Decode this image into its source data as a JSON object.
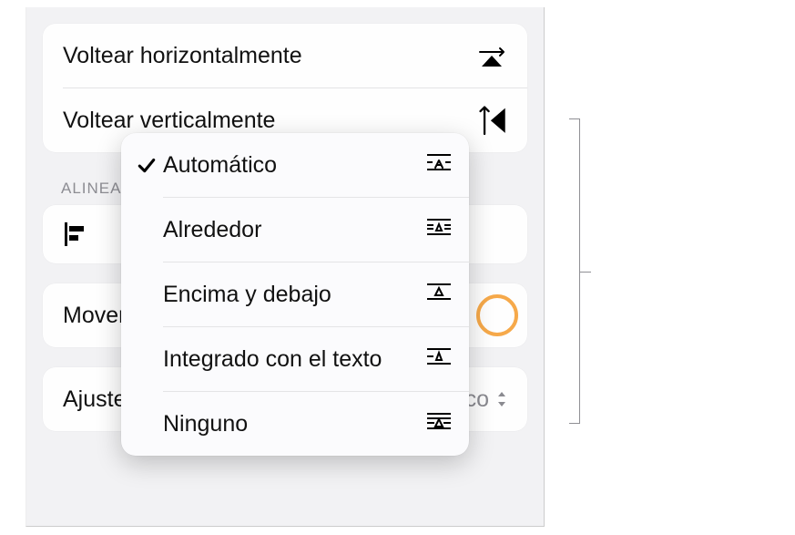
{
  "volteo": {
    "horizontal_label": "Voltear horizontalmente",
    "vertical_label": "Voltear verticalmente"
  },
  "align_section": "Alinear",
  "mover_label": "Mover",
  "wrap": {
    "label": "Ajuste de texto",
    "value": "Automático"
  },
  "popup": {
    "options": [
      {
        "label": "Automático",
        "selected": true
      },
      {
        "label": "Alrededor",
        "selected": false
      },
      {
        "label": "Encima y debajo",
        "selected": false
      },
      {
        "label": "Integrado con el texto",
        "selected": false
      },
      {
        "label": "Ninguno",
        "selected": false
      }
    ]
  }
}
